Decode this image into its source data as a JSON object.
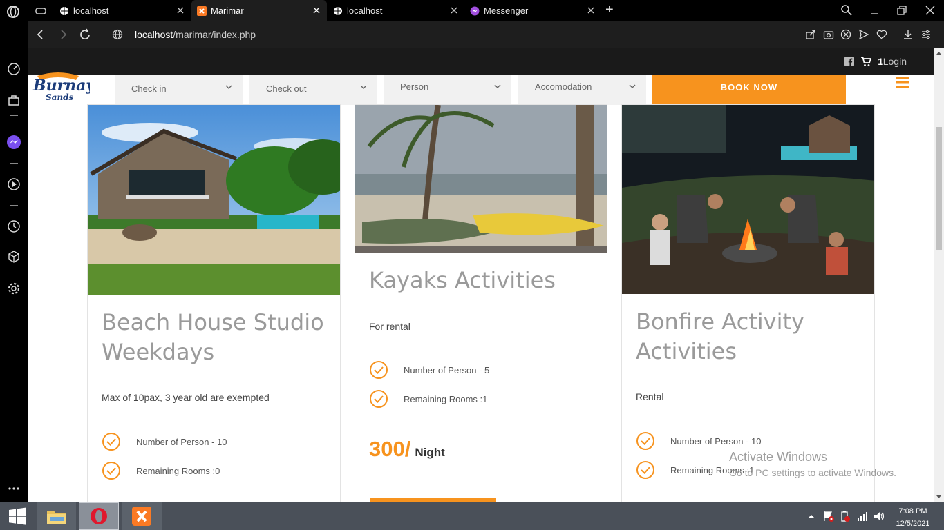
{
  "browser": {
    "tabs": [
      {
        "label": "localhost",
        "active": false
      },
      {
        "label": "Marimar",
        "active": true
      },
      {
        "label": "localhost",
        "active": false
      },
      {
        "label": "Messenger",
        "active": false
      }
    ],
    "new_tab": "+",
    "url_host": "localhost",
    "url_path": "/marimar/index.php"
  },
  "site": {
    "logo_line1": "Burnay",
    "logo_line2": "Sands",
    "cart_count": "1",
    "login_label": "Login",
    "booking": {
      "check_in": "Check in",
      "check_out": "Check out",
      "person": "Person",
      "accomodation": "Accomodation",
      "book_now": "BOOK NOW"
    }
  },
  "cards": [
    {
      "title": "Beach House Studio Weekdays",
      "description": "Max of 10pax, 3 year old are exempted",
      "features": [
        "Number of Person - 10",
        "Remaining Rooms :0"
      ]
    },
    {
      "title": "Kayaks Activities",
      "description": "For rental",
      "features": [
        "Number of Person - 5",
        "Remaining Rooms :1"
      ],
      "price": "300/",
      "price_unit": "Night"
    },
    {
      "title": "Bonfire Activity Activities",
      "description": "Rental",
      "features": [
        "Number of Person - 10",
        "Remaining Rooms :1"
      ]
    }
  ],
  "watermark": {
    "line1": "Activate Windows",
    "line2": "Go to PC settings to activate Windows."
  },
  "taskbar": {
    "time": "7:08 PM",
    "date": "12/5/2021"
  },
  "colors": {
    "accent": "#f7931e",
    "chrome": "#000000",
    "taskbar": "#4a5059"
  }
}
